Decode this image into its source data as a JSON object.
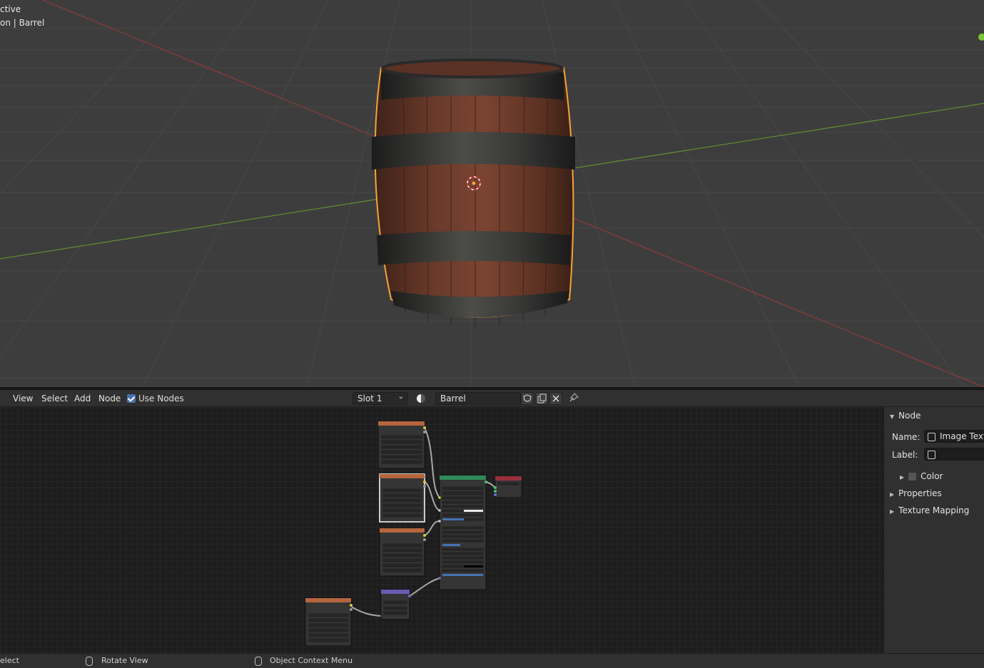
{
  "viewport": {
    "mode_text": "ctive",
    "object_text": "on | Barrel"
  },
  "node_header": {
    "menus": [
      "View",
      "Select",
      "Add",
      "Node"
    ],
    "use_nodes_label": "Use Nodes",
    "use_nodes_checked": true,
    "slot_value": "Slot 1",
    "material_name": "Barrel"
  },
  "sidebar": {
    "panel_title": "Node",
    "name_label": "Name:",
    "name_value": "Image Textur",
    "label_label": "Label:",
    "label_value": "",
    "color_label": "Color",
    "properties_label": "Properties",
    "texture_mapping_label": "Texture Mapping"
  },
  "status_bar": {
    "select_label": "elect",
    "rotate_label": "Rotate View",
    "context_label": "Object Context Menu"
  },
  "colors": {
    "accent_blue": "#4772b3",
    "selection_orange": "#f3a43b",
    "texture_node_header": "#b5653d",
    "bsdf_node_header": "#2f8a5a",
    "output_node_header": "#9a2f3a",
    "vector_node_header": "#6a5ab0"
  }
}
